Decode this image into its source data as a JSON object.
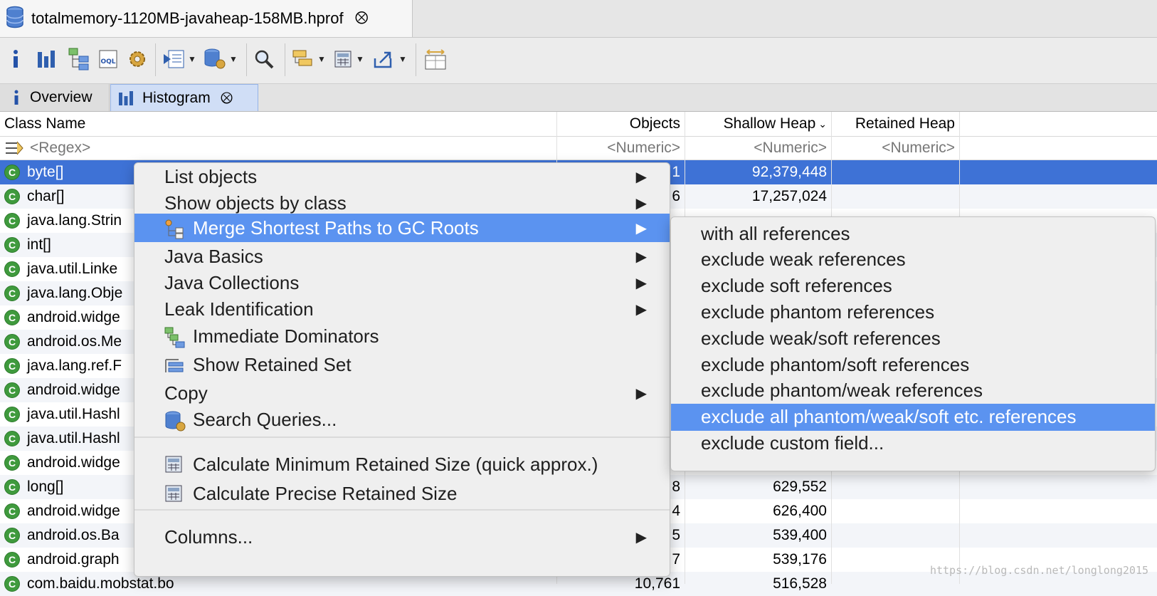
{
  "editor_tab": {
    "title": "totalmemory-1120MB-javaheap-158MB.hprof"
  },
  "toolbar": {
    "buttons": [
      "info-icon",
      "histogram-icon",
      "dominator-tree-icon",
      "oql-icon",
      "thread-overview-icon",
      "run-report-icon",
      "query-browser-icon",
      "search-icon",
      "group-icon",
      "calculator-icon",
      "export-icon",
      "compare-icon"
    ]
  },
  "view_tabs": [
    {
      "label": "Overview",
      "icon": "info-icon"
    },
    {
      "label": "Histogram",
      "icon": "histogram-icon",
      "active": true
    }
  ],
  "table": {
    "columns": [
      "Class Name",
      "Objects",
      "Shallow Heap",
      "Retained Heap"
    ],
    "sort_column": "Shallow Heap",
    "filters": [
      "<Regex>",
      "<Numeric>",
      "<Numeric>",
      "<Numeric>"
    ],
    "rows": [
      {
        "name": "byte[]",
        "objects": "1",
        "shallow": "92,379,448",
        "retained": ""
      },
      {
        "name": "char[]",
        "objects": "6",
        "shallow": "17,257,024",
        "retained": ""
      },
      {
        "name": "java.lang.Strin",
        "objects": "",
        "shallow": "",
        "retained": ""
      },
      {
        "name": "int[]",
        "objects": "",
        "shallow": "",
        "retained": ""
      },
      {
        "name": "java.util.Linke",
        "objects": "",
        "shallow": "",
        "retained": ""
      },
      {
        "name": "java.lang.Obje",
        "objects": "",
        "shallow": "",
        "retained": ""
      },
      {
        "name": "android.widge",
        "objects": "",
        "shallow": "",
        "retained": ""
      },
      {
        "name": "android.os.Me",
        "objects": "",
        "shallow": "",
        "retained": ""
      },
      {
        "name": "java.lang.ref.F",
        "objects": "",
        "shallow": "",
        "retained": ""
      },
      {
        "name": "android.widge",
        "objects": "",
        "shallow": "",
        "retained": ""
      },
      {
        "name": "java.util.Hashl",
        "objects": "",
        "shallow": "",
        "retained": ""
      },
      {
        "name": "java.util.Hashl",
        "objects": "",
        "shallow": "",
        "retained": ""
      },
      {
        "name": "android.widge",
        "objects": "",
        "shallow": "",
        "retained": ""
      },
      {
        "name": "long[]",
        "objects": "8",
        "shallow": "629,552",
        "retained": ""
      },
      {
        "name": "android.widge",
        "objects": "4",
        "shallow": "626,400",
        "retained": ""
      },
      {
        "name": "android.os.Ba",
        "objects": "5",
        "shallow": "539,400",
        "retained": ""
      },
      {
        "name": "android.graph",
        "objects": "7",
        "shallow": "539,176",
        "retained": ""
      },
      {
        "name": "com.baidu.mobstat.bo",
        "objects": "10,761",
        "shallow": "516,528",
        "retained": ""
      }
    ]
  },
  "context_menu": {
    "items": [
      {
        "label": "List objects",
        "submenu": true
      },
      {
        "label": "Show objects by class",
        "submenu": true
      },
      {
        "label": "Merge Shortest Paths to GC Roots",
        "submenu": true,
        "icon": "merge-paths-icon",
        "highlighted": true
      },
      {
        "label": "Java Basics",
        "submenu": true
      },
      {
        "label": "Java Collections",
        "submenu": true
      },
      {
        "label": "Leak Identification",
        "submenu": true
      },
      {
        "label": "Immediate Dominators",
        "icon": "immediate-dominators-icon"
      },
      {
        "label": "Show Retained Set",
        "icon": "retained-set-icon"
      },
      {
        "label": "Copy",
        "submenu": true
      },
      {
        "label": "Search Queries...",
        "icon": "search-queries-icon"
      },
      {
        "label": "Calculate Minimum Retained Size (quick approx.)",
        "icon": "calculator-icon"
      },
      {
        "label": "Calculate Precise Retained Size",
        "icon": "calculator-icon"
      },
      {
        "label": "Columns...",
        "submenu": true
      }
    ],
    "submenu_arrow": "▶"
  },
  "submenu": {
    "items": [
      "with all references",
      "exclude weak references",
      "exclude soft references",
      "exclude phantom references",
      "exclude weak/soft references",
      "exclude phantom/soft references",
      "exclude phantom/weak references",
      "exclude all phantom/weak/soft etc. references",
      "exclude custom field..."
    ],
    "highlighted_index": 7
  },
  "class_icon_letter": "C",
  "watermark": "https://blog.csdn.net/longlong2015",
  "colors": {
    "selection": "#3e72d6",
    "menu_highlight": "#5b93f0",
    "class_icon": "#3f9a3d"
  }
}
